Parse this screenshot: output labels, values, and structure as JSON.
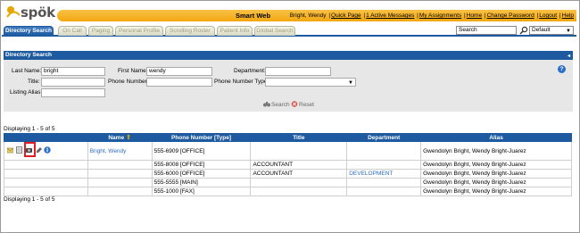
{
  "app": {
    "logo_text": "spök",
    "title": "Smart Web",
    "user": "Bright, Wendy",
    "nav": [
      "Quick Page",
      "1 Active Messages",
      "My Assignments",
      "Home",
      "Change Password",
      "Logout",
      "Help"
    ]
  },
  "tabs": [
    "Directory Search",
    "On Call",
    "Paging",
    "Personal Profile",
    "Scrolling Roster",
    "Patient Info",
    "Global Search"
  ],
  "toolbar": {
    "search_value": "Search",
    "scope_value": "Default"
  },
  "panel": {
    "title": "Directory Search",
    "fields": {
      "last_name_label": "Last Name:",
      "last_name_value": "bright",
      "first_name_label": "First Name:",
      "first_name_value": "wendy",
      "department_label": "Department:",
      "department_value": "",
      "title_label": "Title:",
      "title_value": "",
      "phone_number_label": "Phone Number:",
      "phone_number_value": "",
      "phone_type_label": "Phone Number Type:",
      "phone_type_value": "",
      "listing_alias_label": "Listing Alias:",
      "listing_alias_value": ""
    },
    "search_label": "Search",
    "reset_label": "Reset"
  },
  "results": {
    "summary_top": "Displaying 1 - 5 of 5",
    "summary_bottom": "Displaying 1 - 5 of 5",
    "columns": [
      "Name",
      "Phone Number [Type]",
      "Title",
      "Department",
      "Alias"
    ],
    "rows": [
      {
        "name": "Bright, Wendy",
        "phone": "555-6909 [OFFICE]",
        "title": "",
        "department": "",
        "alias": "Gwendolyn Bright, Wendy Bright-Juarez"
      },
      {
        "name": "",
        "phone": "555-8008 [OFFICE]",
        "title": "ACCOUNTANT",
        "department": "",
        "alias": "Gwendolyn Bright, Wendy Bright-Juarez"
      },
      {
        "name": "",
        "phone": "555-6000 [OFFICE]",
        "title": "ACCOUNTANT",
        "department": "DEVELOPMENT",
        "alias": "Gwendolyn Bright, Wendy Bright-Juarez"
      },
      {
        "name": "",
        "phone": "555-5555 [MAIN]",
        "title": "",
        "department": "",
        "alias": "Gwendolyn Bright, Wendy Bright-Juarez"
      },
      {
        "name": "",
        "phone": "555-1000 [FAX]",
        "title": "",
        "department": "",
        "alias": "Gwendolyn Bright, Wendy Bright-Juarez"
      }
    ]
  },
  "row_icons": [
    "mail-icon",
    "document-icon",
    "camera-icon",
    "edit-icon",
    "info-icon"
  ],
  "colors": {
    "header_orange": "#f3a70f",
    "nav_blue": "#1d5aa0",
    "link_blue": "#2c6cc4",
    "highlight_red": "#e02020"
  }
}
